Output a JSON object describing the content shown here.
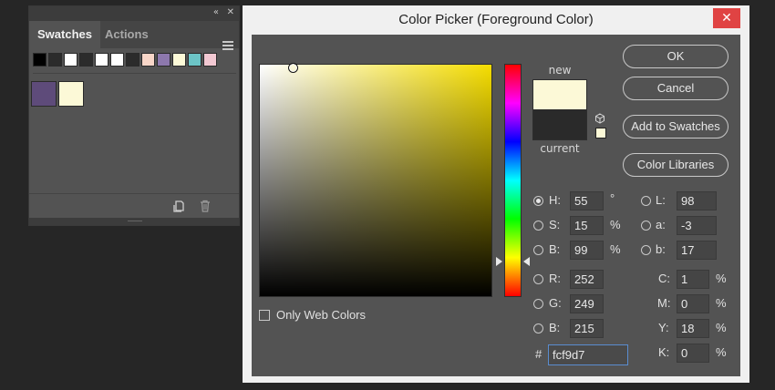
{
  "panel": {
    "tabs": [
      "Swatches",
      "Actions"
    ],
    "controls": {
      "collapse": "«",
      "close": "✕"
    },
    "swatches_row": [
      "#000000",
      "#2b2b2b",
      "#ffffff",
      "#2b2b2b",
      "#ffffff",
      "#ffffff",
      "#2b2b2b",
      "#f8d6c8",
      "#8d78ad",
      "#fcf9d7",
      "#6cc4c6",
      "#f2c8d2"
    ],
    "big_swatches": [
      "#5e4b7a",
      "#fcf9d7"
    ]
  },
  "dialog": {
    "title": "Color Picker (Foreground Color)",
    "close_glyph": "✕",
    "buttons": {
      "ok": "OK",
      "cancel": "Cancel",
      "add_to_swatches": "Add to Swatches",
      "color_libraries": "Color Libraries"
    },
    "labels": {
      "new": "new",
      "current": "current"
    },
    "colors": {
      "new": "#fcf9d7",
      "current": "#2a2a2a",
      "hue_base": "#f5dd00"
    },
    "fields": {
      "H": {
        "label": "H:",
        "value": "55",
        "unit": "°"
      },
      "S": {
        "label": "S:",
        "value": "15",
        "unit": "%"
      },
      "Bv": {
        "label": "B:",
        "value": "99",
        "unit": "%"
      },
      "R": {
        "label": "R:",
        "value": "252"
      },
      "G": {
        "label": "G:",
        "value": "249"
      },
      "B": {
        "label": "B:",
        "value": "215"
      },
      "L": {
        "label": "L:",
        "value": "98"
      },
      "a": {
        "label": "a:",
        "value": "-3"
      },
      "b": {
        "label": "b:",
        "value": "17"
      },
      "C": {
        "label": "C:",
        "value": "1",
        "unit": "%"
      },
      "M": {
        "label": "M:",
        "value": "0",
        "unit": "%"
      },
      "Y": {
        "label": "Y:",
        "value": "18",
        "unit": "%"
      },
      "K": {
        "label": "K:",
        "value": "0",
        "unit": "%"
      }
    },
    "hex": {
      "label": "#",
      "value": "fcf9d7"
    },
    "only_web_colors": "Only Web Colors",
    "selected_mode": "H"
  }
}
